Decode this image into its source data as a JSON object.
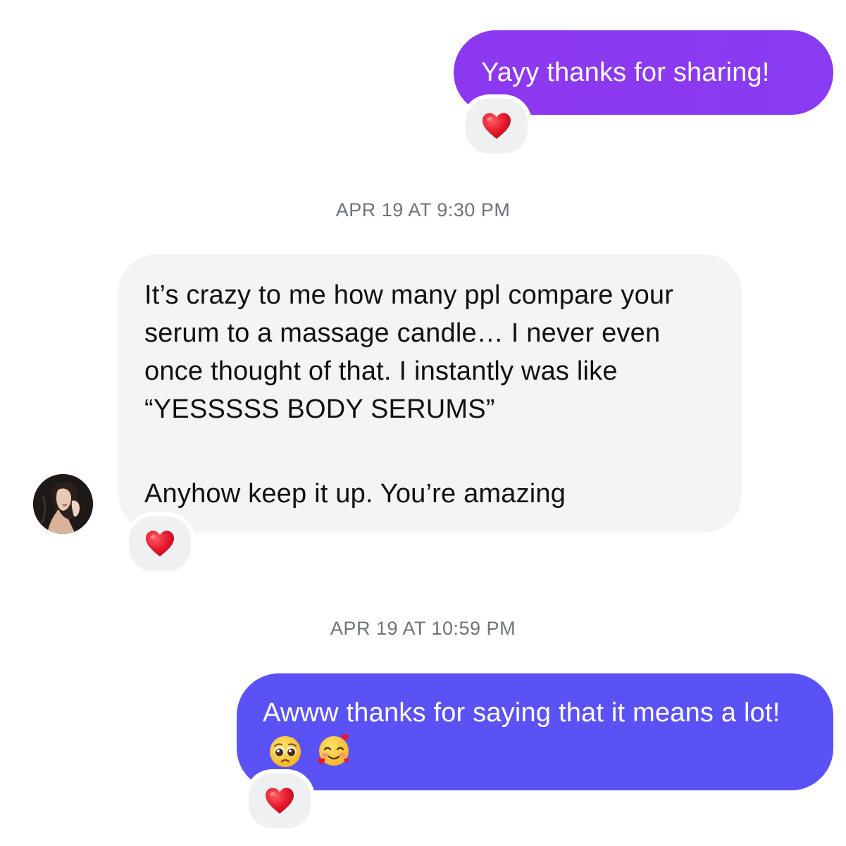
{
  "thread": {
    "messages": [
      {
        "direction": "outgoing",
        "text": "Yayy thanks for sharing!",
        "reaction": "heart-icon"
      },
      {
        "timestamp": "APR 19 AT 9:30 PM"
      },
      {
        "direction": "incoming",
        "paragraphs": [
          "It’s crazy to me how many ppl compare your serum to a massage candle… I never even once thought of that. I instantly was like “YESSSSS BODY SERUMS”",
          "Anyhow keep it up. You’re amazing"
        ],
        "reaction": "heart-icon",
        "avatar": "sender-avatar"
      },
      {
        "timestamp": "APR 19 AT 10:59 PM"
      },
      {
        "direction": "outgoing",
        "text": "Awww thanks for saying that it means a lot!",
        "emojis": [
          "pleading-face-icon",
          "smiling-face-with-hearts-icon"
        ],
        "reaction": "heart-icon"
      }
    ]
  },
  "colors": {
    "outgoing_bubble_1": "#8a3cf2",
    "outgoing_bubble_2": "#5b52f6",
    "incoming_bubble": "#f3f4f6",
    "timestamp_text": "#6e7379",
    "reaction_pill": "#eff0f2",
    "heart": "#e5182b"
  }
}
